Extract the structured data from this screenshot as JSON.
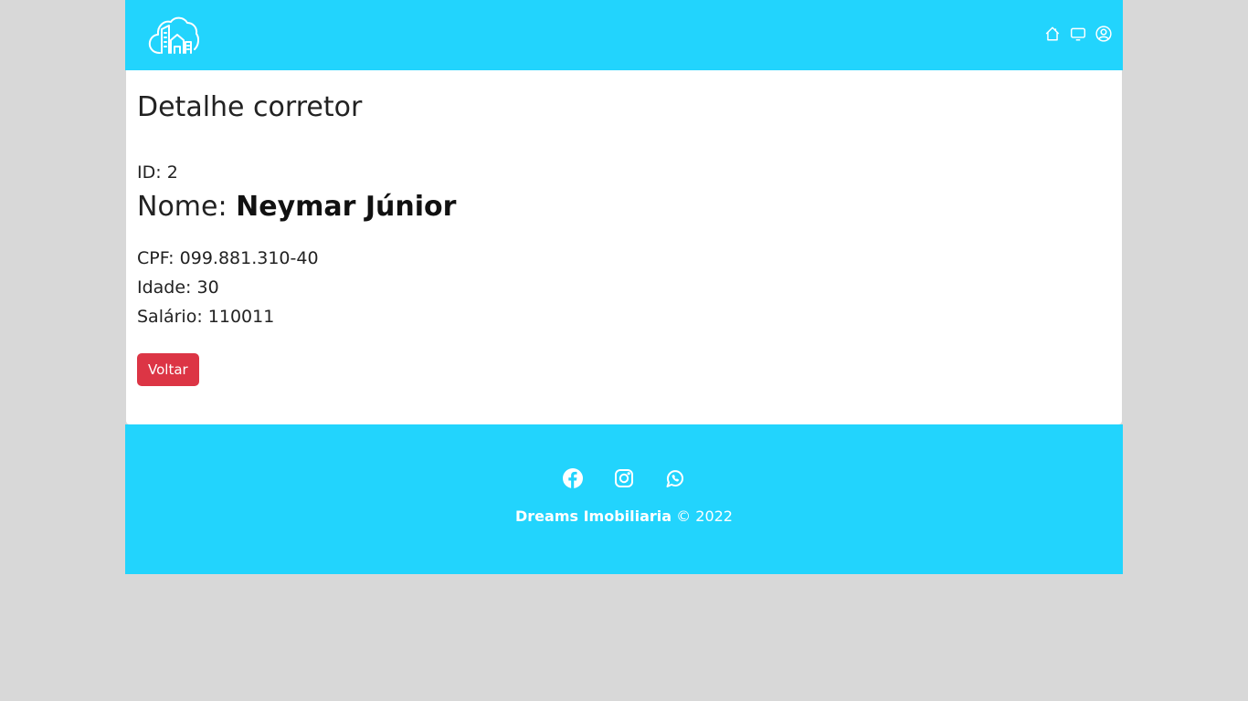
{
  "navbar": {
    "logo_alt": "Dreams Imobiliaria",
    "icons": [
      "home-icon",
      "monitor-icon",
      "user-icon"
    ]
  },
  "detail": {
    "title": "Detalhe corretor",
    "id_label": "ID:",
    "id_value": "2",
    "name_label": "Nome:",
    "name_value": "Neymar Júnior",
    "cpf_label": "CPF:",
    "cpf_value": "099.881.310-40",
    "age_label": "Idade:",
    "age_value": "30",
    "salary_label": "Salário:",
    "salary_value": "110011",
    "back_button": "Voltar"
  },
  "footer": {
    "social_icons": [
      "facebook-icon",
      "instagram-icon",
      "whatsapp-icon"
    ],
    "brand": "Dreams Imobiliaria",
    "copyright": "© 2022"
  },
  "colors": {
    "primary": "#22d4fd",
    "danger": "#dc3545",
    "background": "#d8d8d8"
  }
}
